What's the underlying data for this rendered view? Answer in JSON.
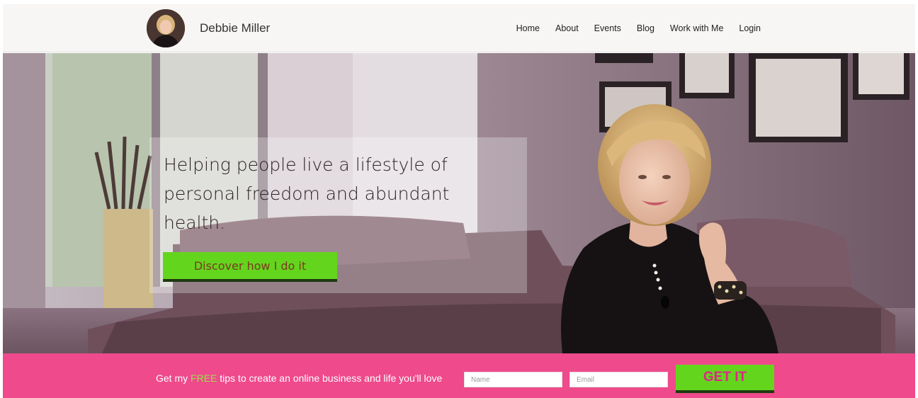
{
  "header": {
    "site_name": "Debbie Miller",
    "nav": [
      "Home",
      "About",
      "Events",
      "Blog",
      "Work with Me",
      "Login"
    ]
  },
  "hero": {
    "headline": "Helping people live a lifestyle of personal freedom and abundant health.",
    "cta_label": "Discover how I do it"
  },
  "signup": {
    "text_before": "Get my ",
    "text_free": "FREE",
    "text_after": " tips to create an online business and life you'll love",
    "name_placeholder": "Name",
    "email_placeholder": "Email",
    "button_label": "GET IT"
  },
  "colors": {
    "header_bg": "#f7f6f4",
    "cta_green": "#64d51d",
    "signup_pink": "#ee4a8c",
    "free_text": "#9fe04a",
    "get_it_text": "#e0248c"
  }
}
